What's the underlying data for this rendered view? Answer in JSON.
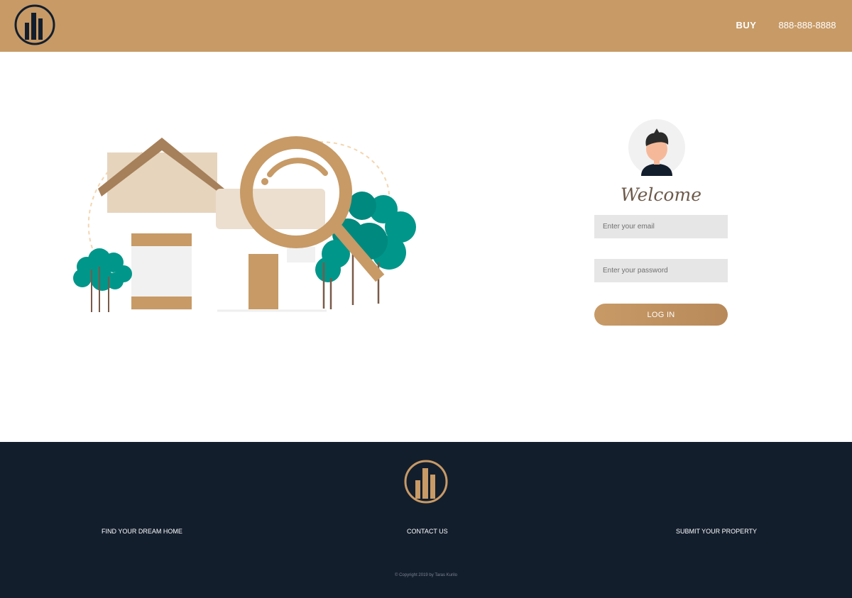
{
  "header": {
    "nav": {
      "buy_label": "BUY",
      "phone": "888-888-8888"
    },
    "logo_icon": "building-logo-icon"
  },
  "hero": {
    "illustration": "house-magnifier-illustration"
  },
  "login": {
    "avatar_icon": "user-avatar-icon",
    "welcome": "Welcome",
    "email_placeholder": "Enter your email",
    "password_placeholder": "Enter your password",
    "button_label": "LOG IN"
  },
  "footer": {
    "logo_icon": "building-logo-icon",
    "links": [
      "FIND YOUR DREAM HOME",
      "CONTACT US",
      "SUBMIT YOUR PROPERTY"
    ],
    "copyright": "© Copyright 2019 by Taras Kurilo"
  },
  "colors": {
    "brand": "#c79a66",
    "dark": "#131e2d",
    "tree": "#00968a"
  }
}
